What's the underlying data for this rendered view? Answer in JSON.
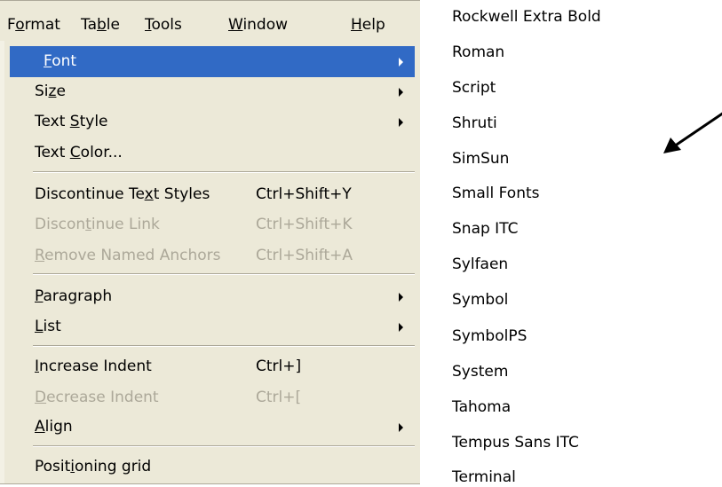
{
  "menubar": {
    "items": [
      {
        "name": "Format",
        "mnemonic_index": 1
      },
      {
        "name": "Table",
        "mnemonic_index": 2
      },
      {
        "name": "Tools",
        "mnemonic_index": 0
      },
      {
        "name": "Window",
        "mnemonic_index": 0
      },
      {
        "name": "Help",
        "mnemonic_index": 0
      }
    ]
  },
  "format_menu": {
    "items": [
      {
        "label": "Font",
        "shortcut": "",
        "submenu": true,
        "enabled": true,
        "selected": true,
        "mnemonic_index": 0
      },
      {
        "label": "Size",
        "shortcut": "",
        "submenu": true,
        "enabled": true,
        "selected": false,
        "mnemonic_index": 2
      },
      {
        "label": "Text Style",
        "shortcut": "",
        "submenu": true,
        "enabled": true,
        "selected": false,
        "mnemonic_index": 5
      },
      {
        "label": "Text Color...",
        "shortcut": "",
        "submenu": false,
        "enabled": true,
        "selected": false,
        "mnemonic_index": 5
      },
      {
        "label": "Discontinue Text Styles",
        "shortcut": "Ctrl+Shift+Y",
        "submenu": false,
        "enabled": true,
        "selected": false,
        "mnemonic_index": 14
      },
      {
        "label": "Discontinue Link",
        "shortcut": "Ctrl+Shift+K",
        "submenu": false,
        "enabled": false,
        "selected": false,
        "mnemonic_index": 6
      },
      {
        "label": "Remove Named Anchors",
        "shortcut": "Ctrl+Shift+A",
        "submenu": false,
        "enabled": false,
        "selected": false,
        "mnemonic_index": 0
      },
      {
        "label": "Paragraph",
        "shortcut": "",
        "submenu": true,
        "enabled": true,
        "selected": false,
        "mnemonic_index": 0
      },
      {
        "label": "List",
        "shortcut": "",
        "submenu": true,
        "enabled": true,
        "selected": false,
        "mnemonic_index": 0
      },
      {
        "label": "Increase Indent",
        "shortcut": "Ctrl+]",
        "submenu": false,
        "enabled": true,
        "selected": false,
        "mnemonic_index": 0
      },
      {
        "label": "Decrease Indent",
        "shortcut": "Ctrl+[",
        "submenu": false,
        "enabled": false,
        "selected": false,
        "mnemonic_index": 0
      },
      {
        "label": "Align",
        "shortcut": "",
        "submenu": true,
        "enabled": true,
        "selected": false,
        "mnemonic_index": 0
      },
      {
        "label": "Positioning grid",
        "shortcut": "",
        "submenu": false,
        "enabled": true,
        "selected": false,
        "mnemonic_index": 5
      }
    ]
  },
  "font_list": {
    "items": [
      "Rockwell Extra Bold",
      "Roman",
      "Script",
      "Shruti",
      "SimSun",
      "Small Fonts",
      "Snap ITC",
      "Sylfaen",
      "Symbol",
      "SymbolPS",
      "System",
      "Tahoma",
      "Tempus Sans ITC",
      "Terminal"
    ]
  },
  "colors": {
    "menu_bg": "#ece9d8",
    "highlight": "#316ac5",
    "disabled_text": "#aca899",
    "separator": "#aca899"
  },
  "icons": {
    "submenu_arrow": "chevron-right-icon",
    "pointer": "arrow-pointer-icon"
  }
}
